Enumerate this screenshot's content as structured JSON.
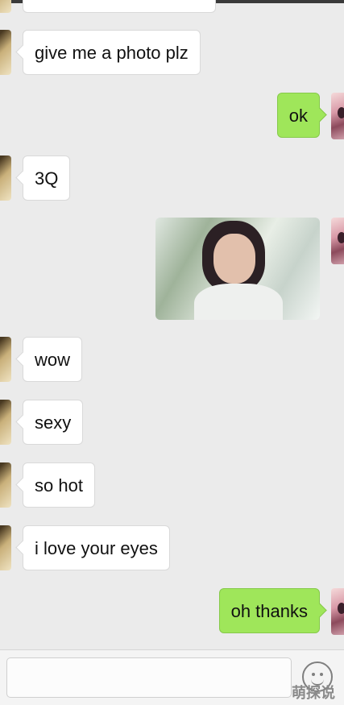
{
  "messages": [
    {
      "side": "left",
      "type": "text",
      "text": ""
    },
    {
      "side": "left",
      "type": "text",
      "text": "give me a photo plz"
    },
    {
      "side": "right",
      "type": "text",
      "text": "ok"
    },
    {
      "side": "left",
      "type": "text",
      "text": "3Q"
    },
    {
      "side": "right",
      "type": "image",
      "text": ""
    },
    {
      "side": "left",
      "type": "text",
      "text": "wow"
    },
    {
      "side": "left",
      "type": "text",
      "text": "sexy"
    },
    {
      "side": "left",
      "type": "text",
      "text": "so hot"
    },
    {
      "side": "left",
      "type": "text",
      "text": "i love your eyes"
    },
    {
      "side": "right",
      "type": "text",
      "text": "oh thanks"
    }
  ],
  "input": {
    "placeholder": ""
  },
  "icons": {
    "emoji": "smiley-face-icon"
  },
  "watermark": "萌探说",
  "colors": {
    "sent_bubble": "#9fe65a",
    "received_bubble": "#ffffff",
    "background": "#ebebeb"
  }
}
